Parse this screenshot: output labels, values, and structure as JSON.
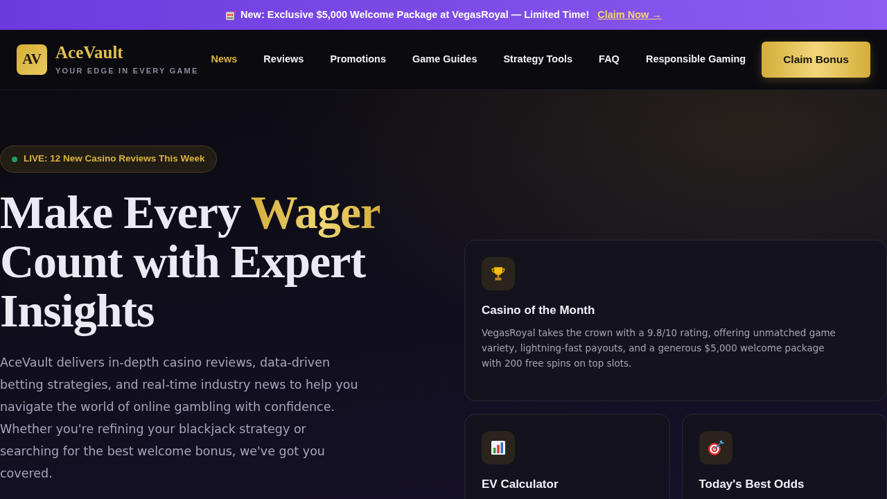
{
  "announcement": {
    "text": "New: Exclusive $5,000 Welcome Package at VegasRoyal — Limited Time!",
    "link": "Claim Now →"
  },
  "logo": {
    "mark": "AV",
    "name": "AceVault",
    "tagline": "YOUR EDGE IN EVERY GAME"
  },
  "nav": {
    "items": [
      {
        "label": "News",
        "selected": true
      },
      {
        "label": "Reviews",
        "selected": false
      },
      {
        "label": "Promotions",
        "selected": false
      },
      {
        "label": "Game Guides",
        "selected": false
      },
      {
        "label": "Strategy Tools",
        "selected": false
      },
      {
        "label": "FAQ",
        "selected": false
      },
      {
        "label": "Responsible Gaming",
        "selected": false
      }
    ],
    "cta": "Claim Bonus"
  },
  "hero": {
    "badge": {
      "text": "LIVE: 12 New Casino Reviews This Week",
      "live": true
    },
    "heading": {
      "before": "Make Every",
      "highlight": "Wager",
      "after": "Count with Expert Insights"
    },
    "description": "AceVault delivers in-depth casino reviews, data-driven betting strategies, and real-time industry news to help you navigate the world of online gambling with confidence. Whether you're refining your blackjack strategy or searching for the best welcome bonus, we've got you covered."
  },
  "cards": [
    {
      "kind": "trophy",
      "title": "Casino of the Month",
      "description": "VegasRoyal takes the crown with a 9.8/10 rating, offering unmatched game variety, lightning-fast payouts, and a generous $5,000 welcome package with 200 free spins on top slots."
    },
    {
      "kind": "chart",
      "title": "EV Calculator"
    },
    {
      "kind": "target",
      "title": "Today's Best Odds"
    }
  ]
}
